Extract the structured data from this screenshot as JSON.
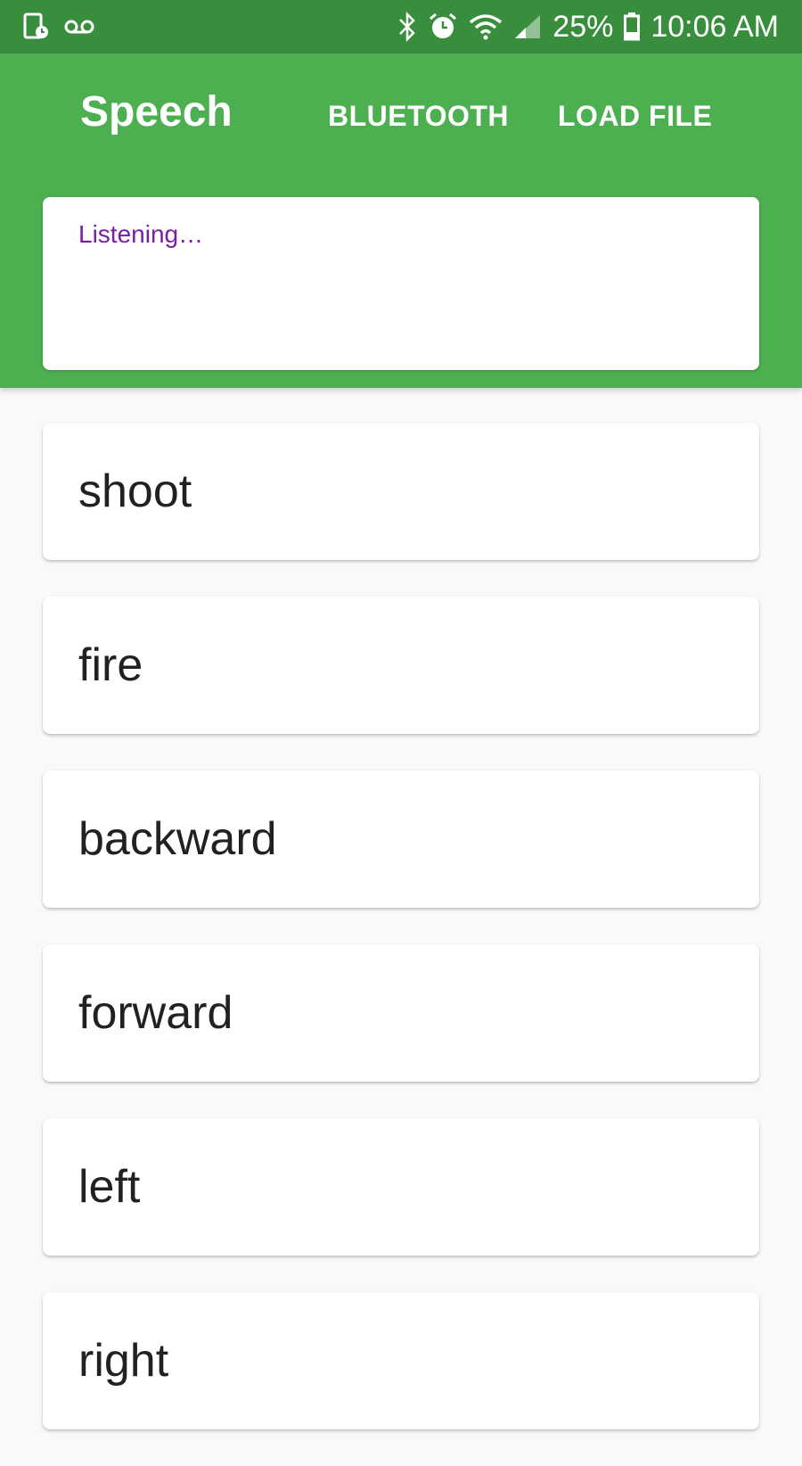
{
  "status_bar": {
    "battery_percent": "25%",
    "time": "10:06 AM",
    "icons": [
      "screen-record-icon",
      "voicemail-icon",
      "bluetooth-icon",
      "alarm-icon",
      "wifi-icon",
      "signal-icon",
      "battery-icon"
    ]
  },
  "app_bar": {
    "title": "Speech",
    "actions": [
      {
        "label": "BLUETOOTH"
      },
      {
        "label": "LOAD FILE"
      }
    ]
  },
  "listening": {
    "status": "Listening…"
  },
  "commands": [
    {
      "label": "shoot"
    },
    {
      "label": "fire"
    },
    {
      "label": "backward"
    },
    {
      "label": "forward"
    },
    {
      "label": "left"
    },
    {
      "label": "right"
    }
  ],
  "colors": {
    "status_bar": "#388e3c",
    "app_bar": "#4caf50",
    "listening_text": "#7b1fa2",
    "background": "#f9f9f9"
  }
}
